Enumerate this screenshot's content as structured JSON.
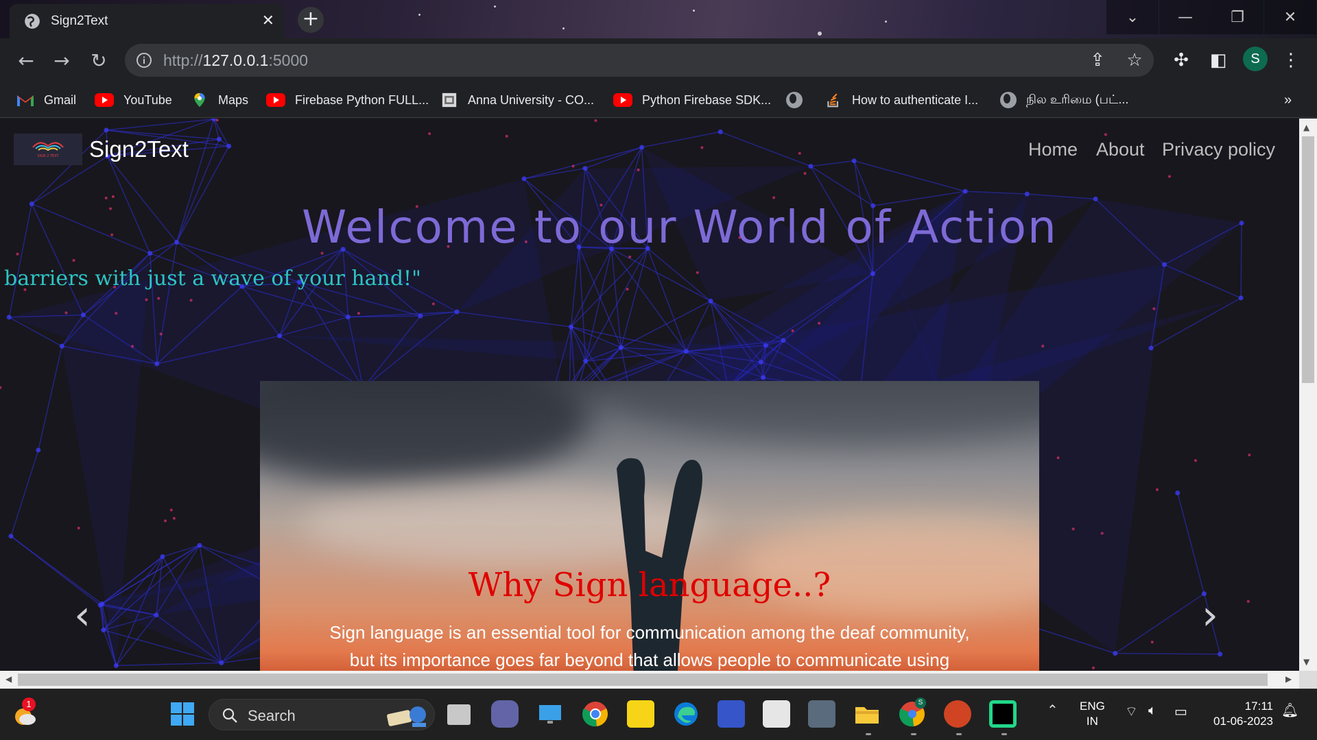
{
  "browser": {
    "tab_title": "Sign2Text",
    "url_scheme": "http://",
    "url_host": "127.0.0.1",
    "url_port": ":5000",
    "profile_initial": "S"
  },
  "bookmarks": [
    {
      "label": "Gmail",
      "icon": "gmail-icon"
    },
    {
      "label": "YouTube",
      "icon": "youtube-icon"
    },
    {
      "label": "Maps",
      "icon": "maps-icon"
    },
    {
      "label": "Firebase Python FULL...",
      "icon": "youtube-icon"
    },
    {
      "label": "Anna University - CO...",
      "icon": "university-icon"
    },
    {
      "label": "Python Firebase SDK...",
      "icon": "youtube-icon"
    },
    {
      "label": "",
      "icon": "globe-icon"
    },
    {
      "label": "How to authenticate I...",
      "icon": "stackoverflow-icon"
    },
    {
      "label": "நில உரிமை (பட்...",
      "icon": "globe-icon"
    }
  ],
  "site": {
    "brand": "Sign2Text",
    "logo_text": "SIGN 2 TEXT",
    "nav": [
      "Home",
      "About",
      "Privacy policy"
    ],
    "hero_title": "Welcome to our World of Action",
    "marquee_text": "barriers with just a wave of your hand!\"",
    "carousel": {
      "title": "Why Sign language..?",
      "text_line1": "Sign language is an essential tool for communication among the deaf community,",
      "text_line2": "but its importance goes far beyond that allows people to communicate using"
    }
  },
  "taskbar": {
    "search_label": "Search",
    "notification_count": "1",
    "language_line1": "ENG",
    "language_line2": "IN",
    "time": "17:11",
    "date": "01-06-2023",
    "chrome_profile_badge": "S"
  },
  "colors": {
    "hero_title": "#7e6ad6",
    "marquee": "#2ec4c4",
    "carousel_title": "#e00000",
    "network_lines": "#2f2fd6"
  }
}
